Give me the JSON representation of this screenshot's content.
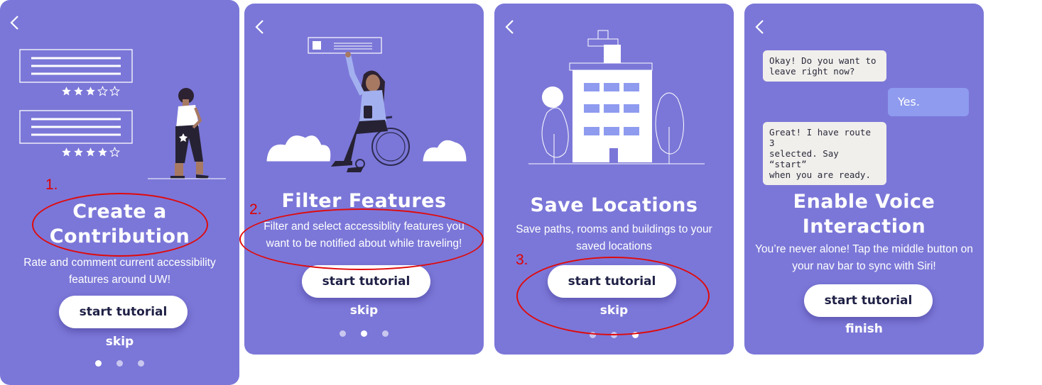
{
  "annotations": {
    "one": "1.",
    "two": "2.",
    "three": "3."
  },
  "screens": [
    {
      "title_line1": "Create a",
      "title_line2": "Contribution",
      "desc_line1": "Rate and comment current accessibility",
      "desc_line2": "features around UW!",
      "button": "start tutorial",
      "secondary": "skip",
      "page_index": 1,
      "page_count": 3,
      "ratings": [
        3,
        4
      ],
      "rating_max": 5
    },
    {
      "title": "Filter Features",
      "desc_line1": "Filter and select accessiblity features you",
      "desc_line2": "want to be notified about while traveling!",
      "button": "start tutorial",
      "secondary": "skip",
      "page_index": 2,
      "page_count": 3
    },
    {
      "title": "Save Locations",
      "desc_line1": "Save paths, rooms and buildings to your",
      "desc_line2": "saved locations",
      "button": "start tutorial",
      "secondary": "skip",
      "page_index": 3,
      "page_count": 3
    },
    {
      "title_line1": "Enable Voice",
      "title_line2": "Interaction",
      "desc_line1": "You’re never alone! Tap the middle button on",
      "desc_line2": "your nav bar to sync with Siri!",
      "button": "start tutorial",
      "secondary": "finish",
      "chat": [
        {
          "from": "assistant",
          "line1": "Okay! Do you want to",
          "line2": "leave right now?"
        },
        {
          "from": "user",
          "text": "Yes."
        },
        {
          "from": "assistant",
          "line1": "Great! I have route 3",
          "line2": "selected. Say “start”",
          "line3": "when you are ready."
        }
      ]
    }
  ],
  "colors": {
    "card": "#7b77d8",
    "annotation": "#e00000",
    "button_text": "#1f2045"
  },
  "icons": [
    "back-arrow-icon",
    "star-icon"
  ]
}
